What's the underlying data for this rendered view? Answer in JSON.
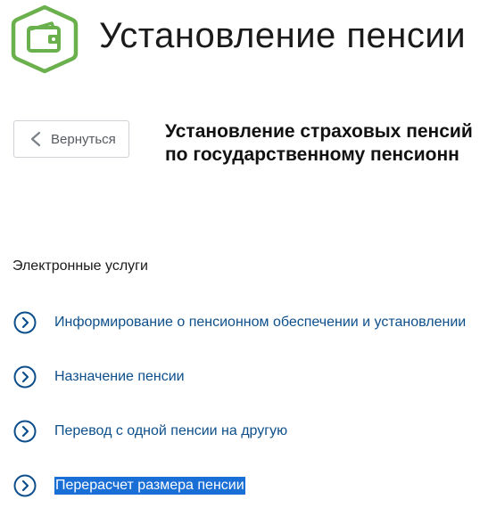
{
  "header": {
    "icon": "wallet-icon",
    "icon_color": "#6ab04c",
    "title": "Установление пенсии"
  },
  "back_button": {
    "icon": "chevron-left-icon",
    "label": "Вернуться"
  },
  "subtitle": {
    "line1": "Установление страховых пенсий",
    "line2": "по государственному пенсионн"
  },
  "services": {
    "heading": "Электронные услуги",
    "link_color": "#0d4f8b",
    "items": [
      {
        "label": "Информирование о пенсионном обеспечении и установлении",
        "icon": "chevron-right-circle-icon",
        "selected": false
      },
      {
        "label": "Назначение пенсии",
        "icon": "chevron-right-circle-icon",
        "selected": false
      },
      {
        "label": "Перевод с одной пенсии на другую",
        "icon": "chevron-right-circle-icon",
        "selected": false
      },
      {
        "label": "Перерасчет размера пенсии",
        "icon": "chevron-right-circle-icon",
        "selected": true
      }
    ]
  }
}
